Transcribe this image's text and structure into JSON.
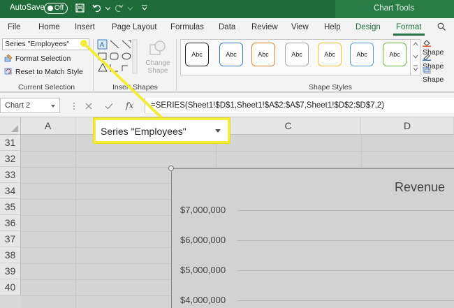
{
  "titlebar": {
    "autosave_label": "AutoSave",
    "toggle_state": "Off",
    "context_tab": "Chart Tools"
  },
  "tabs": [
    "File",
    "Home",
    "Insert",
    "Page Layout",
    "Formulas",
    "Data",
    "Review",
    "View",
    "Help",
    "Design",
    "Format"
  ],
  "active_tab": "Format",
  "ribbon": {
    "current_selection": {
      "combo_value": "Series \"Employees\"",
      "format_selection": "Format Selection",
      "reset_label": "Reset to Match Style",
      "group_label": "Current Selection"
    },
    "insert_shapes": {
      "change_shape_line1": "Change",
      "change_shape_line2": "Shape",
      "group_label": "Insert Shapes"
    },
    "shape_styles": {
      "style_label": "Abc",
      "group_label": "Shape Styles",
      "options": [
        "Shape",
        "Shape",
        "Shape"
      ]
    }
  },
  "formula_bar": {
    "name_box": "Chart 2",
    "fx_label": "fx",
    "formula": "=SERIES(Sheet1!$D$1,Sheet1!$A$2:$A$7,Sheet1!$D$2:$D$7,2)"
  },
  "grid": {
    "columns": [
      "A",
      "B",
      "C",
      "D"
    ],
    "rows": [
      "31",
      "32",
      "33",
      "34",
      "35",
      "36",
      "37",
      "38",
      "39",
      "40"
    ]
  },
  "chart": {
    "title": "Revenue",
    "y_labels": [
      "$7,000,000",
      "$6,000,000",
      "$5,000,000",
      "$4,000,000"
    ]
  },
  "callout": {
    "text": "Series \"Employees\""
  },
  "colors": {
    "title_green": "#1f6b3a",
    "accent_green": "#217346",
    "callout_yellow": "#f2ec3a"
  }
}
